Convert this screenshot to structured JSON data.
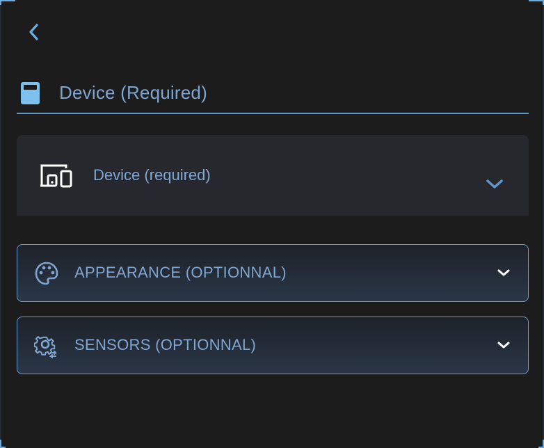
{
  "header": {
    "title": "Device (Required)",
    "icon": "calculator-icon"
  },
  "device_field": {
    "label": "Device (required)",
    "icon": "devices-icon"
  },
  "sections": [
    {
      "label": "APPEARANCE (OPTIONNAL)",
      "icon": "palette-icon"
    },
    {
      "label": "SENSORS (OPTIONNAL)",
      "icon": "gear-sync-icon"
    }
  ],
  "colors": {
    "background": "#1c1c1c",
    "accent": "#6aaee0",
    "text": "#7fa5d2",
    "card": "#27282e"
  }
}
